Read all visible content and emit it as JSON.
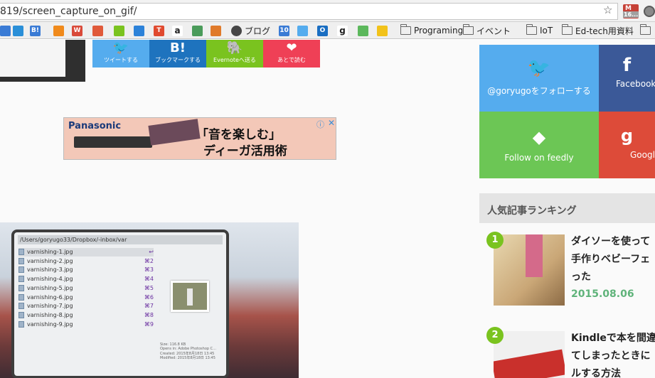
{
  "browser": {
    "url": "819/screen_capture_on_gif/",
    "gmail_count": "16..."
  },
  "bookmarks": [
    {
      "type": "favicon",
      "text": "",
      "icon": "blue-square-icon",
      "color": "#3a7bd5"
    },
    {
      "type": "favicon",
      "text": "",
      "icon": "blue-drop-icon",
      "color": "#2a8fd8"
    },
    {
      "type": "favicon",
      "text": "B!",
      "icon": "hatena-bookmark-icon",
      "color": "#3a7bd5"
    },
    {
      "type": "favicon",
      "text": "",
      "icon": "orange-circle-icon",
      "color": "#f08a1c"
    },
    {
      "type": "favicon",
      "text": "W",
      "icon": "w-icon",
      "color": "#d94a3a"
    },
    {
      "type": "favicon",
      "text": "",
      "icon": "red-globe-icon",
      "color": "#e05a3a"
    },
    {
      "type": "favicon",
      "text": "",
      "icon": "green-rectangle-icon",
      "color": "#7ac31f"
    },
    {
      "type": "favicon",
      "text": "",
      "icon": "dropbox-icon",
      "color": "#2c82d9"
    },
    {
      "type": "favicon",
      "text": "T",
      "icon": "t-icon",
      "color": "#e04a2f"
    },
    {
      "type": "favicon",
      "text": "a",
      "icon": "amazon-icon",
      "color": "#ffffff"
    },
    {
      "type": "favicon",
      "text": "",
      "icon": "maps-icon",
      "color": "#4a9b5a"
    },
    {
      "type": "favicon",
      "text": "",
      "icon": "firefox-icon",
      "color": "#e07a2a"
    },
    {
      "type": "labeled",
      "text": "ブログ",
      "icon": "wordpress-icon",
      "color": "#464646"
    },
    {
      "type": "favicon",
      "text": "10",
      "icon": "calendar-icon",
      "color": "#3a7bd5"
    },
    {
      "type": "favicon",
      "text": "",
      "icon": "twitter-icon",
      "color": "#55acee"
    },
    {
      "type": "favicon",
      "text": "O",
      "icon": "outlook-icon",
      "color": "#1a6ec2"
    },
    {
      "type": "favicon",
      "text": "g",
      "icon": "g-icon",
      "color": "#ffffff"
    },
    {
      "type": "favicon",
      "text": "",
      "icon": "green-circle-icon",
      "color": "#5cb85c"
    },
    {
      "type": "favicon",
      "text": "",
      "icon": "yellow-character-icon",
      "color": "#f2c21a"
    },
    {
      "type": "folder",
      "text": "Programing",
      "icon": "folder-icon"
    },
    {
      "type": "folder",
      "text": "イベント",
      "icon": "folder-icon"
    },
    {
      "type": "folder",
      "text": "IoT",
      "icon": "folder-icon"
    },
    {
      "type": "folder",
      "text": "Ed-tech用資料",
      "icon": "folder-icon"
    },
    {
      "type": "folder",
      "text": "",
      "icon": "folder-icon"
    }
  ],
  "share_buttons": [
    {
      "label": "ツイートする",
      "icon": "twitter-icon",
      "glyph": "🐦",
      "color": "#55acee"
    },
    {
      "label": "ブックマークする",
      "icon": "hatena-bookmark-icon",
      "glyph": "B!",
      "color": "#1e73be"
    },
    {
      "label": "Evernoteへ送る",
      "icon": "evernote-icon",
      "glyph": "🐘",
      "color": "#7ac31f"
    },
    {
      "label": "あとで読む",
      "icon": "pocket-icon",
      "glyph": "❤",
      "color": "#ef4056"
    }
  ],
  "ad": {
    "brand": "Panasonic",
    "headline": "「音を楽しむ」",
    "subline": "ディーガ活用術"
  },
  "sidebar": {
    "follow_twitter": "@goryugoをフォローする",
    "facebook": "Facebook",
    "feedly": "Follow on feedly",
    "google": "Googl",
    "ranking_title": "人気記事ランキング",
    "ranking": [
      {
        "rank": "1",
        "title": "ダイソーを使って\n手作りベビーフェ\nった",
        "date": "2015.08.06"
      },
      {
        "rank": "2",
        "title": "Kindleで本を間違\nてしまったときに\nルする方法",
        "date": ""
      }
    ]
  },
  "finder": {
    "path": "/Users/goryugo33/Dropbox/-inbox/var",
    "files": [
      {
        "name": "varnishing-1.jpg",
        "key": "↩"
      },
      {
        "name": "varnishing-2.jpg",
        "key": "⌘2"
      },
      {
        "name": "varnishing-3.jpg",
        "key": "⌘3"
      },
      {
        "name": "varnishing-4.jpg",
        "key": "⌘4"
      },
      {
        "name": "varnishing-5.jpg",
        "key": "⌘5"
      },
      {
        "name": "varnishing-6.jpg",
        "key": "⌘6"
      },
      {
        "name": "varnishing-7.jpg",
        "key": "⌘7"
      },
      {
        "name": "varnishing-8.jpg",
        "key": "⌘8"
      },
      {
        "name": "varnishing-9.jpg",
        "key": "⌘9"
      }
    ],
    "meta": [
      "Size: 116.8 KB",
      "Opens in: Adobe Photoshop C...",
      "Created: 2015年8月18日 13:45",
      "Modified: 2015年8月18日 13:45"
    ]
  },
  "colors": {
    "twitter": "#55acee",
    "facebook": "#3b5998",
    "feedly": "#6cc655",
    "google": "#dd4b39",
    "rank_green": "#7ac31f"
  }
}
